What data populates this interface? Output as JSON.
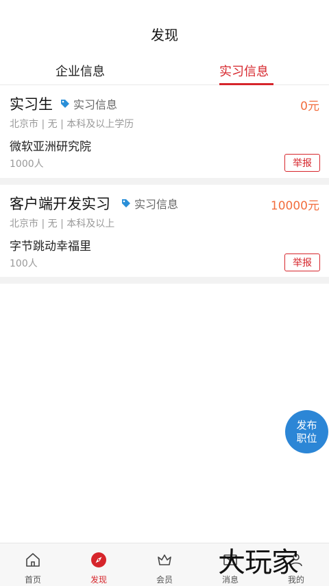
{
  "header": {
    "title": "发现"
  },
  "tabs": [
    {
      "label": "企业信息",
      "active": false
    },
    {
      "label": "实习信息",
      "active": true
    }
  ],
  "jobs": [
    {
      "title": "实习生",
      "tag": "实习信息",
      "salary": "0元",
      "meta": "北京市 | 无 | 本科及以上学历",
      "company": "微软亚洲研究院",
      "size": "1000人",
      "report_label": "举报"
    },
    {
      "title": "客户端开发实习",
      "tag": "实习信息",
      "salary": "10000元",
      "meta": "北京市 | 无 | 本科及以上",
      "company": "字节跳动幸福里",
      "size": "100人",
      "report_label": "举报"
    }
  ],
  "fab": {
    "line1": "发布",
    "line2": "职位"
  },
  "bottom_nav": [
    {
      "label": "首页",
      "icon": "home-icon"
    },
    {
      "label": "发现",
      "icon": "compass-icon",
      "active": true
    },
    {
      "label": "会员",
      "icon": "crown-icon"
    },
    {
      "label": "消息",
      "icon": "message-icon"
    },
    {
      "label": "我的",
      "icon": "user-icon"
    }
  ],
  "watermark": "大玩家",
  "colors": {
    "accent": "#d6252b",
    "salary": "#f26d3d",
    "fab": "#2c86d6",
    "tag_icon": "#2a8fd8"
  }
}
